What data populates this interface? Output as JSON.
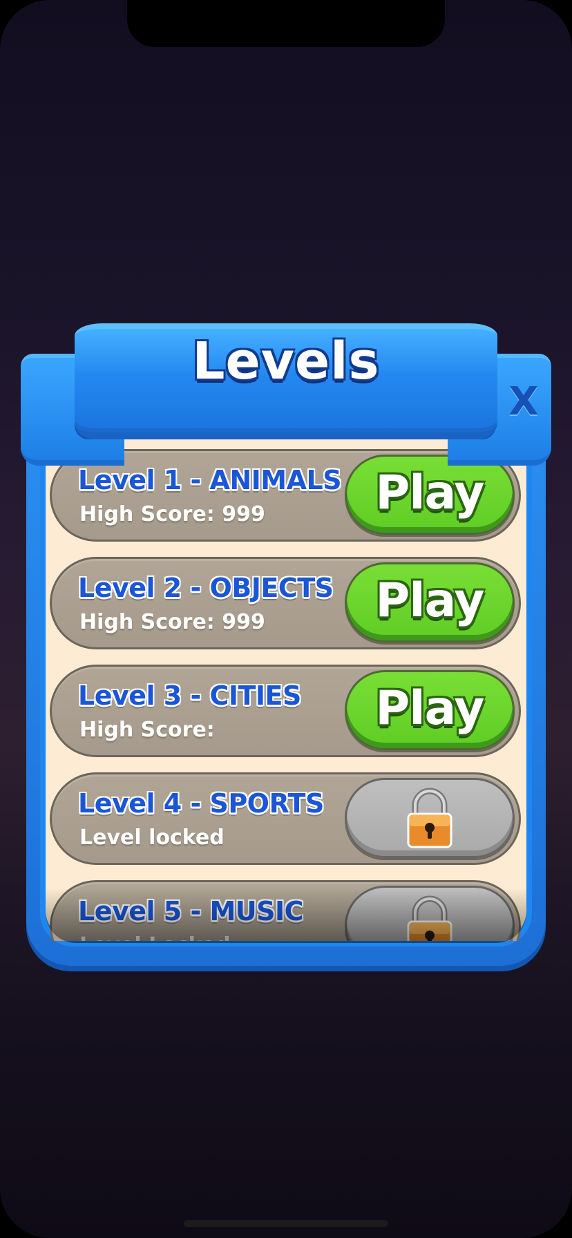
{
  "popup": {
    "title": "Levels",
    "close_label": "X"
  },
  "levels": [
    {
      "title": "Level 1 - ANIMALS",
      "subtitle": "High Score: 999",
      "status": "unlocked",
      "action": "Play"
    },
    {
      "title": "Level 2 - OBJECTS",
      "subtitle": "High Score: 999",
      "status": "unlocked",
      "action": "Play"
    },
    {
      "title": "Level 3 - CITIES",
      "subtitle": "High Score:",
      "status": "unlocked",
      "action": "Play"
    },
    {
      "title": "Level 4 - SPORTS",
      "subtitle": "Level locked",
      "status": "locked",
      "icon": "padlock-icon"
    },
    {
      "title": "Level 5 - MUSIC",
      "subtitle": "Level Locked",
      "status": "locked",
      "icon": "padlock-icon"
    }
  ],
  "colors": {
    "ribbon_blue": "#2488f0",
    "panel_cream": "#fdecd3",
    "row_taupe": "#a59a8b",
    "play_green": "#5fcd24",
    "level_title_blue": "#1a56d6",
    "lock_gray": "#a9a9a9",
    "lock_orange": "#e98b2a"
  }
}
